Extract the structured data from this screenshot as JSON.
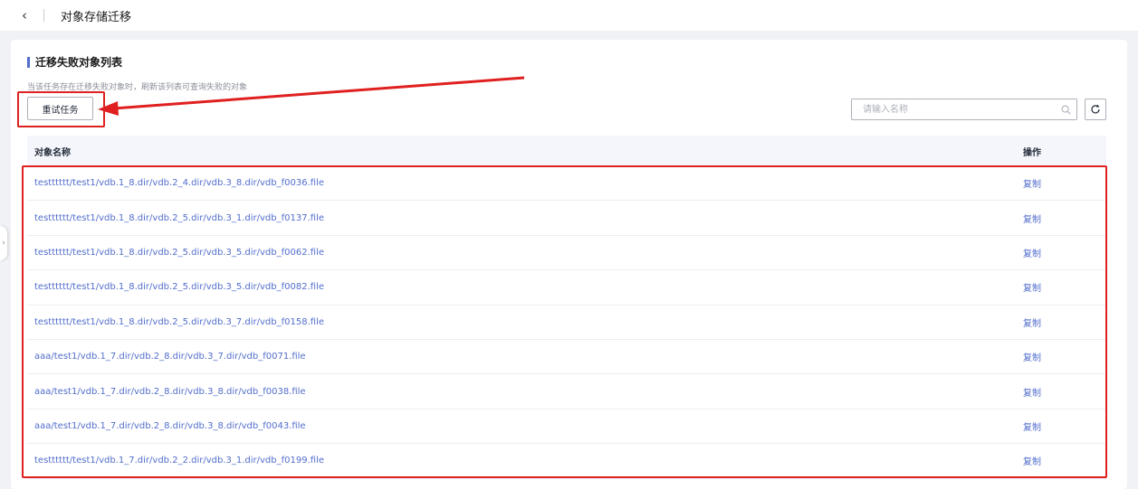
{
  "header": {
    "back_icon": "chevron-left-icon",
    "title": "对象存储迁移"
  },
  "section": {
    "title": "迁移失败对象列表",
    "hint": "当该任务存在迁移失败对象时，刷新该列表可查询失败的对象"
  },
  "toolbar": {
    "retry_label": "重试任务",
    "search_placeholder": "请输入名称",
    "search_icon": "search-icon",
    "refresh_icon": "refresh-icon"
  },
  "table": {
    "columns": [
      "对象名称",
      "操作"
    ],
    "rows": [
      {
        "name": "testttttt/test1/vdb.1_8.dir/vdb.2_4.dir/vdb.3_8.dir/vdb_f0036.file",
        "action": "复制"
      },
      {
        "name": "testttttt/test1/vdb.1_8.dir/vdb.2_5.dir/vdb.3_1.dir/vdb_f0137.file",
        "action": "复制"
      },
      {
        "name": "testttttt/test1/vdb.1_8.dir/vdb.2_5.dir/vdb.3_5.dir/vdb_f0062.file",
        "action": "复制"
      },
      {
        "name": "testttttt/test1/vdb.1_8.dir/vdb.2_5.dir/vdb.3_5.dir/vdb_f0082.file",
        "action": "复制"
      },
      {
        "name": "testttttt/test1/vdb.1_8.dir/vdb.2_5.dir/vdb.3_7.dir/vdb_f0158.file",
        "action": "复制"
      },
      {
        "name": "aaa/test1/vdb.1_7.dir/vdb.2_8.dir/vdb.3_7.dir/vdb_f0071.file",
        "action": "复制"
      },
      {
        "name": "aaa/test1/vdb.1_7.dir/vdb.2_8.dir/vdb.3_8.dir/vdb_f0038.file",
        "action": "复制"
      },
      {
        "name": "aaa/test1/vdb.1_7.dir/vdb.2_8.dir/vdb.3_8.dir/vdb_f0043.file",
        "action": "复制"
      },
      {
        "name": "testttttt/test1/vdb.1_7.dir/vdb.2_2.dir/vdb.3_1.dir/vdb_f0199.file",
        "action": "复制"
      }
    ]
  },
  "colors": {
    "accent": "#526ecc",
    "annotation_red": "#e02020"
  }
}
